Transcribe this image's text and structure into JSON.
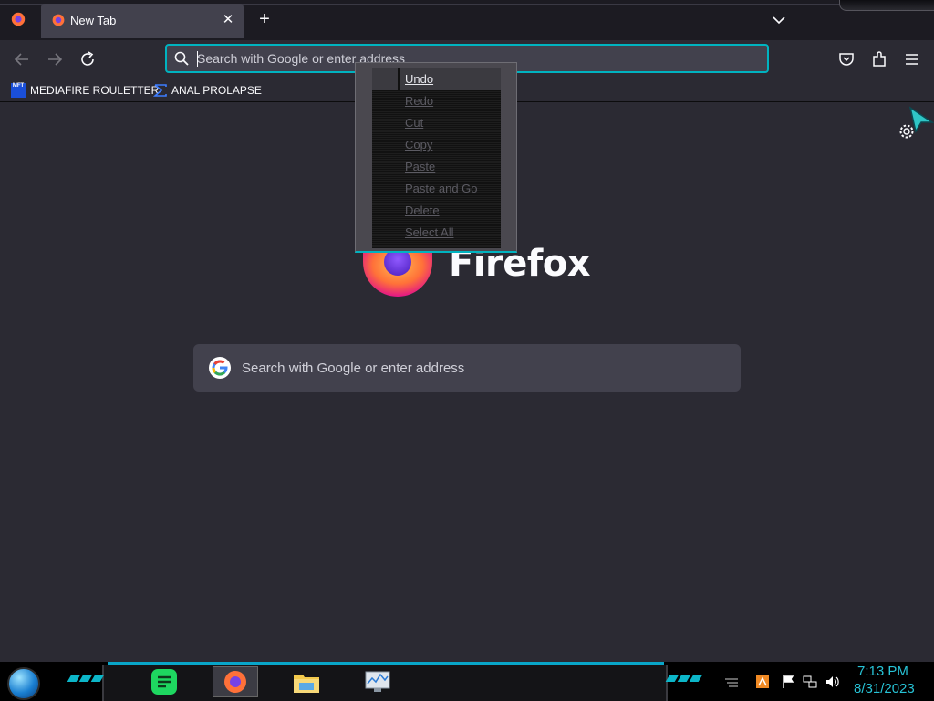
{
  "browser": {
    "tab": {
      "label": "New Tab",
      "close": "✕"
    },
    "new_tab": "+",
    "urlbar": {
      "placeholder": "Search with Google or enter address"
    },
    "bookmarks": [
      {
        "label": "MEDIAFIRE ROULETTER",
        "icon_text": "MFT"
      },
      {
        "label": "ANAL PROLAPSE"
      }
    ]
  },
  "content": {
    "wordmark": "Firefox",
    "search_placeholder": "Search with Google or enter address"
  },
  "context_menu": {
    "items": [
      {
        "label": "Undo",
        "enabled": true
      },
      {
        "label": "Redo",
        "enabled": false
      },
      {
        "label": "Cut",
        "enabled": false
      },
      {
        "label": "Copy",
        "enabled": false
      },
      {
        "label": "Paste",
        "enabled": false
      },
      {
        "label": "Paste and Go",
        "enabled": false
      },
      {
        "label": "Delete",
        "enabled": false
      },
      {
        "label": "Select All",
        "enabled": false
      }
    ]
  },
  "taskbar": {
    "apps": [
      "spotify-icon",
      "firefox-icon",
      "file-explorer-icon",
      "task-manager-icon"
    ],
    "time": "7:13 PM",
    "date": "8/31/2023"
  },
  "colors": {
    "accent": "#00b3c0",
    "clock": "#27c3d6",
    "toolbar": "#2b2a33",
    "field": "#42414d"
  }
}
